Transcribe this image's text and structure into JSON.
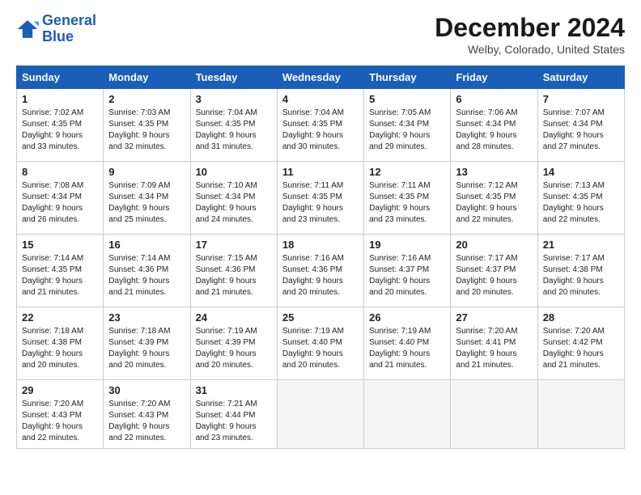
{
  "logo": {
    "line1": "General",
    "line2": "Blue"
  },
  "title": "December 2024",
  "location": "Welby, Colorado, United States",
  "headers": [
    "Sunday",
    "Monday",
    "Tuesday",
    "Wednesday",
    "Thursday",
    "Friday",
    "Saturday"
  ],
  "weeks": [
    [
      {
        "day": 1,
        "sunrise": "7:02 AM",
        "sunset": "4:35 PM",
        "daylight": "9 hours and 33 minutes."
      },
      {
        "day": 2,
        "sunrise": "7:03 AM",
        "sunset": "4:35 PM",
        "daylight": "9 hours and 32 minutes."
      },
      {
        "day": 3,
        "sunrise": "7:04 AM",
        "sunset": "4:35 PM",
        "daylight": "9 hours and 31 minutes."
      },
      {
        "day": 4,
        "sunrise": "7:04 AM",
        "sunset": "4:35 PM",
        "daylight": "9 hours and 30 minutes."
      },
      {
        "day": 5,
        "sunrise": "7:05 AM",
        "sunset": "4:34 PM",
        "daylight": "9 hours and 29 minutes."
      },
      {
        "day": 6,
        "sunrise": "7:06 AM",
        "sunset": "4:34 PM",
        "daylight": "9 hours and 28 minutes."
      },
      {
        "day": 7,
        "sunrise": "7:07 AM",
        "sunset": "4:34 PM",
        "daylight": "9 hours and 27 minutes."
      }
    ],
    [
      {
        "day": 8,
        "sunrise": "7:08 AM",
        "sunset": "4:34 PM",
        "daylight": "9 hours and 26 minutes."
      },
      {
        "day": 9,
        "sunrise": "7:09 AM",
        "sunset": "4:34 PM",
        "daylight": "9 hours and 25 minutes."
      },
      {
        "day": 10,
        "sunrise": "7:10 AM",
        "sunset": "4:34 PM",
        "daylight": "9 hours and 24 minutes."
      },
      {
        "day": 11,
        "sunrise": "7:11 AM",
        "sunset": "4:35 PM",
        "daylight": "9 hours and 23 minutes."
      },
      {
        "day": 12,
        "sunrise": "7:11 AM",
        "sunset": "4:35 PM",
        "daylight": "9 hours and 23 minutes."
      },
      {
        "day": 13,
        "sunrise": "7:12 AM",
        "sunset": "4:35 PM",
        "daylight": "9 hours and 22 minutes."
      },
      {
        "day": 14,
        "sunrise": "7:13 AM",
        "sunset": "4:35 PM",
        "daylight": "9 hours and 22 minutes."
      }
    ],
    [
      {
        "day": 15,
        "sunrise": "7:14 AM",
        "sunset": "4:35 PM",
        "daylight": "9 hours and 21 minutes."
      },
      {
        "day": 16,
        "sunrise": "7:14 AM",
        "sunset": "4:36 PM",
        "daylight": "9 hours and 21 minutes."
      },
      {
        "day": 17,
        "sunrise": "7:15 AM",
        "sunset": "4:36 PM",
        "daylight": "9 hours and 21 minutes."
      },
      {
        "day": 18,
        "sunrise": "7:16 AM",
        "sunset": "4:36 PM",
        "daylight": "9 hours and 20 minutes."
      },
      {
        "day": 19,
        "sunrise": "7:16 AM",
        "sunset": "4:37 PM",
        "daylight": "9 hours and 20 minutes."
      },
      {
        "day": 20,
        "sunrise": "7:17 AM",
        "sunset": "4:37 PM",
        "daylight": "9 hours and 20 minutes."
      },
      {
        "day": 21,
        "sunrise": "7:17 AM",
        "sunset": "4:38 PM",
        "daylight": "9 hours and 20 minutes."
      }
    ],
    [
      {
        "day": 22,
        "sunrise": "7:18 AM",
        "sunset": "4:38 PM",
        "daylight": "9 hours and 20 minutes."
      },
      {
        "day": 23,
        "sunrise": "7:18 AM",
        "sunset": "4:39 PM",
        "daylight": "9 hours and 20 minutes."
      },
      {
        "day": 24,
        "sunrise": "7:19 AM",
        "sunset": "4:39 PM",
        "daylight": "9 hours and 20 minutes."
      },
      {
        "day": 25,
        "sunrise": "7:19 AM",
        "sunset": "4:40 PM",
        "daylight": "9 hours and 20 minutes."
      },
      {
        "day": 26,
        "sunrise": "7:19 AM",
        "sunset": "4:40 PM",
        "daylight": "9 hours and 21 minutes."
      },
      {
        "day": 27,
        "sunrise": "7:20 AM",
        "sunset": "4:41 PM",
        "daylight": "9 hours and 21 minutes."
      },
      {
        "day": 28,
        "sunrise": "7:20 AM",
        "sunset": "4:42 PM",
        "daylight": "9 hours and 21 minutes."
      }
    ],
    [
      {
        "day": 29,
        "sunrise": "7:20 AM",
        "sunset": "4:43 PM",
        "daylight": "9 hours and 22 minutes."
      },
      {
        "day": 30,
        "sunrise": "7:20 AM",
        "sunset": "4:43 PM",
        "daylight": "9 hours and 22 minutes."
      },
      {
        "day": 31,
        "sunrise": "7:21 AM",
        "sunset": "4:44 PM",
        "daylight": "9 hours and 23 minutes."
      },
      null,
      null,
      null,
      null
    ]
  ]
}
